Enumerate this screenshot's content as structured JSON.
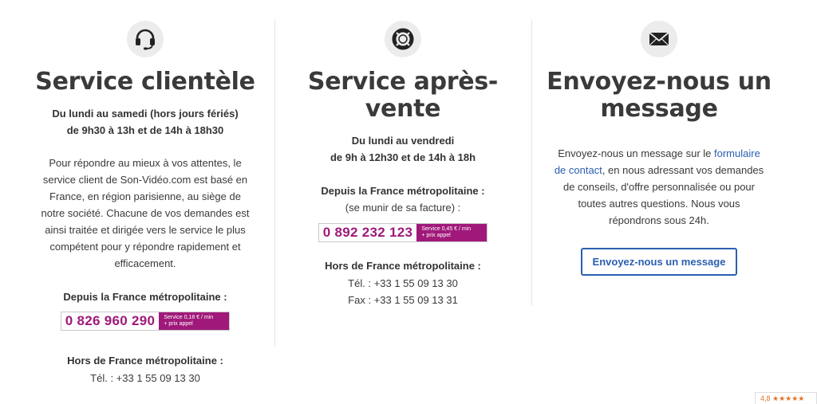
{
  "col1": {
    "title": "Service clientèle",
    "hours_line1": "Du lundi au samedi (hors jours fériés)",
    "hours_line2": "de 9h30 à 13h et de 14h à 18h30",
    "para_lines": [
      "Pour répondre au mieux à vos attentes, le",
      "service client de Son-Vidéo.com est basé en",
      "France, en région parisienne, au siège de",
      "notre société. Chacune de vos demandes est",
      "ainsi traitée et dirigée vers le service le plus",
      "compétent pour y répondre rapidement et",
      "efficacement."
    ],
    "metro_label": "Depuis la France métropolitaine :",
    "phone_number": "0 826 960 290",
    "phone_tag_line1": "Service 0,18 € / min",
    "phone_tag_line2": "+ prix appel",
    "intl_label": "Hors de France métropolitaine :",
    "intl_tel": "Tél. : +33 1 55 09 13 30"
  },
  "col2": {
    "title_line1": "Service après-",
    "title_line2": "vente",
    "hours_line1": "Du lundi au vendredi",
    "hours_line2": "de 9h à 12h30 et de 14h à 18h",
    "metro_label": "Depuis la France métropolitaine :",
    "metro_note": "(se munir de sa facture) :",
    "phone_number": "0 892 232 123",
    "phone_tag_line1": "Service 0,45 € / min",
    "phone_tag_line2": "+ prix appel",
    "intl_label": "Hors de France métropolitaine :",
    "intl_tel": "Tél. : +33 1 55 09 13 30",
    "intl_fax": "Fax : +33 1 55 09 13 31"
  },
  "col3": {
    "title_line1": "Envoyez-nous un",
    "title_line2": "message",
    "para_part1": "Envoyez-nous un message sur le ",
    "link_part1": "formulaire",
    "link_part2": "de contact",
    "para_part2": ", en nous adressant vos demandes",
    "para_line3": "de conseils, d'offre personnalisée ou pour",
    "para_line4": "toutes autres questions. Nous vous",
    "para_line5": "répondrons sous 24h.",
    "button_label": "Envoyez-nous un message"
  },
  "rating": {
    "text": "4,8 ★★★★★"
  },
  "colors": {
    "accent": "#2a5fb0",
    "phone": "#a0197a"
  },
  "icons": [
    "headset-icon",
    "lifebuoy-icon",
    "envelope-icon"
  ]
}
